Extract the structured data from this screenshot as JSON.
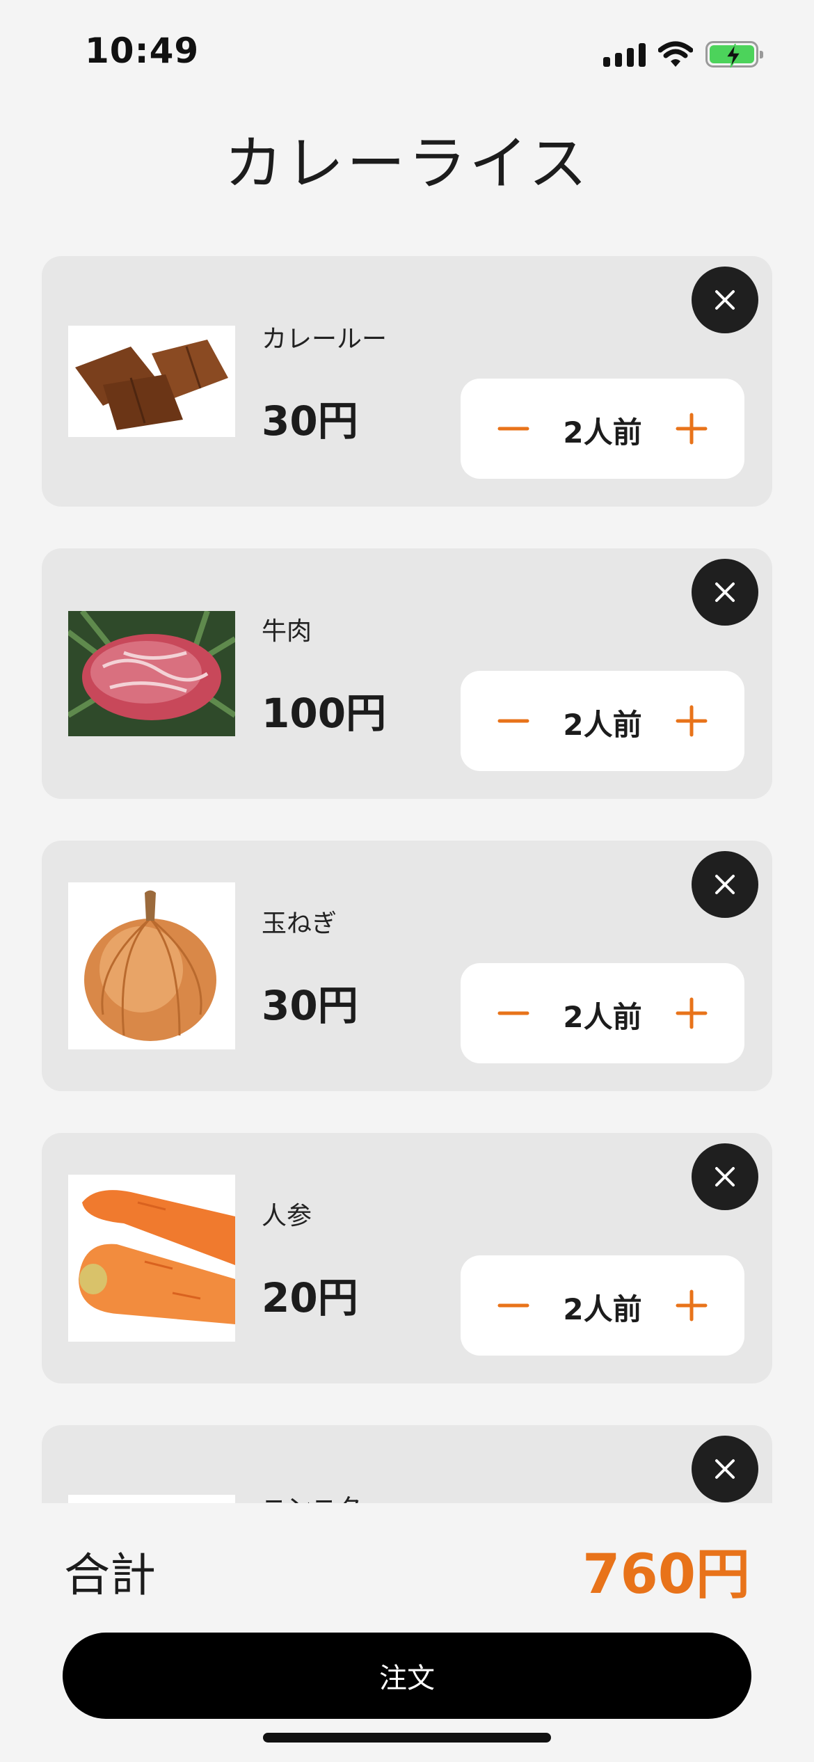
{
  "status_bar": {
    "time": "10:49",
    "icons": [
      "signal-icon",
      "wifi-icon",
      "battery-charging-icon"
    ]
  },
  "page": {
    "title": "カレーライス"
  },
  "cart": {
    "items": [
      {
        "name": "カレールー",
        "price": "30円",
        "quantity": "2人前",
        "image": "curry-roux-image"
      },
      {
        "name": "牛肉",
        "price": "100円",
        "quantity": "2人前",
        "image": "beef-image"
      },
      {
        "name": "玉ねぎ",
        "price": "30円",
        "quantity": "2人前",
        "image": "onion-image"
      },
      {
        "name": "人参",
        "price": "20円",
        "quantity": "2人前",
        "image": "carrot-image"
      },
      {
        "name": "ニンニク",
        "price": "",
        "quantity": "",
        "image": "garlic-image"
      }
    ],
    "icons": {
      "remove": "close-icon",
      "decrement": "minus-icon",
      "increment": "plus-icon"
    }
  },
  "footer": {
    "total_label": "合計",
    "total_value": "760円",
    "order_label": "注文"
  },
  "colors": {
    "accent": "#e8731a",
    "background": "#f4f4f4",
    "card": "#e7e7e7",
    "button": "#000000"
  }
}
